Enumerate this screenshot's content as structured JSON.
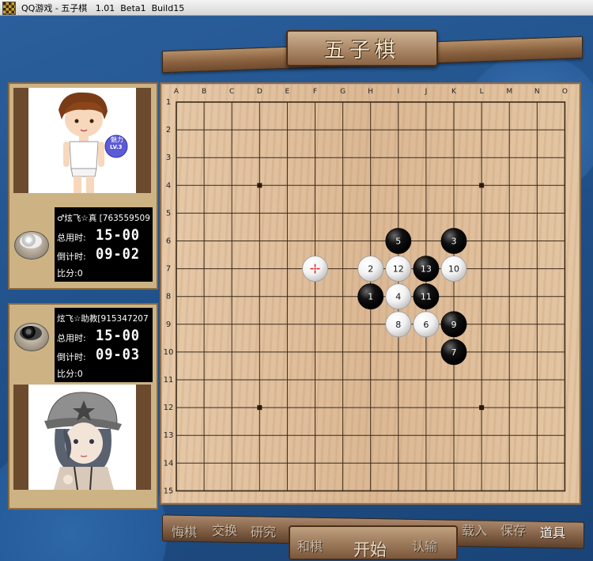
{
  "window": {
    "title": "QQ游戏 - 五子棋   1.01  Beta1  Build15"
  },
  "banner": {
    "title": "五子棋"
  },
  "players": [
    {
      "name": "♂炫飞☆真  [763559509",
      "total_label": "总用时:",
      "total_time": "15-00",
      "countdown_label": "倒计时:",
      "countdown_time": "09-02",
      "score_label": "比分:",
      "score": "0",
      "stone": "white",
      "badge_text": "魅力",
      "badge_level": "LV.3"
    },
    {
      "name": "炫飞☆助教[915347207",
      "total_label": "总用时:",
      "total_time": "15-00",
      "countdown_label": "倒计时:",
      "countdown_time": "09-03",
      "score_label": "比分:",
      "score": "0",
      "stone": "black"
    }
  ],
  "board": {
    "columns": [
      "A",
      "B",
      "C",
      "D",
      "E",
      "F",
      "G",
      "H",
      "I",
      "J",
      "K",
      "L",
      "M",
      "N",
      "O"
    ],
    "rows": [
      "1",
      "2",
      "3",
      "4",
      "5",
      "6",
      "7",
      "8",
      "9",
      "10",
      "11",
      "12",
      "13",
      "14",
      "15"
    ],
    "star_points": [
      [
        "D",
        "4"
      ],
      [
        "L",
        "4"
      ],
      [
        "D",
        "12"
      ],
      [
        "L",
        "12"
      ]
    ],
    "stones": [
      {
        "n": 1,
        "color": "black",
        "col": "H",
        "row": 8
      },
      {
        "n": 2,
        "color": "white",
        "col": "H",
        "row": 7
      },
      {
        "n": 3,
        "color": "black",
        "col": "K",
        "row": 6
      },
      {
        "n": 4,
        "color": "white",
        "col": "I",
        "row": 8
      },
      {
        "n": 5,
        "color": "black",
        "col": "I",
        "row": 6
      },
      {
        "n": 6,
        "color": "white",
        "col": "J",
        "row": 9
      },
      {
        "n": 7,
        "color": "black",
        "col": "K",
        "row": 10
      },
      {
        "n": 8,
        "color": "white",
        "col": "I",
        "row": 9
      },
      {
        "n": 9,
        "color": "black",
        "col": "K",
        "row": 9
      },
      {
        "n": 10,
        "color": "white",
        "col": "K",
        "row": 7
      },
      {
        "n": 11,
        "color": "black",
        "col": "J",
        "row": 8
      },
      {
        "n": 12,
        "color": "white",
        "col": "I",
        "row": 7
      },
      {
        "n": 13,
        "color": "black",
        "col": "J",
        "row": 7
      }
    ],
    "cursor": {
      "col": "F",
      "row": 7,
      "color": "white"
    },
    "colors": {
      "black_stone": "#111111",
      "white_stone": "#f2f2f2",
      "line": "#3a2a1a",
      "cursor_mark": "#e02020"
    }
  },
  "commands": {
    "undo": "悔棋",
    "swap": "交换",
    "study": "研究",
    "draw": "和棋",
    "start": "开始",
    "resign": "认输",
    "load": "载入",
    "save": "保存",
    "items": "道具"
  }
}
